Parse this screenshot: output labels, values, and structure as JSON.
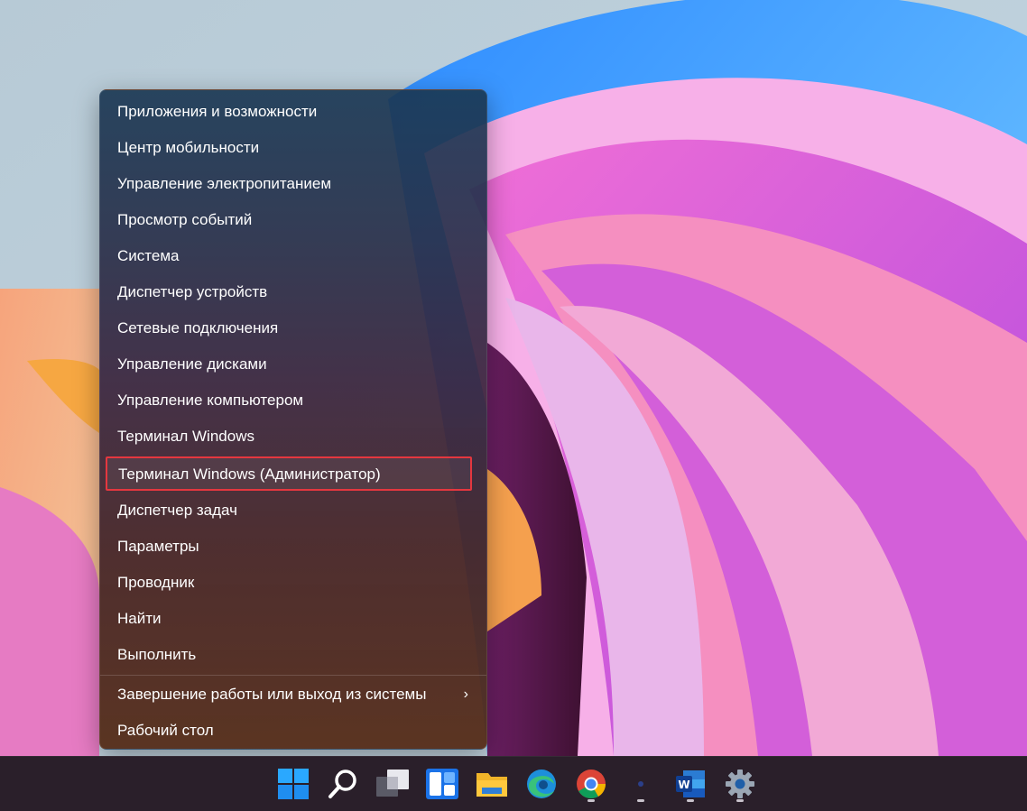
{
  "menu": {
    "items": [
      {
        "label": "Приложения и возможности"
      },
      {
        "label": "Центр мобильности"
      },
      {
        "label": "Управление электропитанием"
      },
      {
        "label": "Просмотр событий"
      },
      {
        "label": "Система"
      },
      {
        "label": "Диспетчер устройств"
      },
      {
        "label": "Сетевые подключения"
      },
      {
        "label": "Управление дисками"
      },
      {
        "label": "Управление компьютером"
      },
      {
        "label": "Терминал Windows"
      },
      {
        "label": "Терминал Windows (Администратор)"
      },
      {
        "label": "Диспетчер задач"
      },
      {
        "label": "Параметры"
      },
      {
        "label": "Проводник"
      },
      {
        "label": "Найти"
      },
      {
        "label": "Выполнить"
      },
      {
        "label": "Завершение работы или выход из системы",
        "icon": "chevron-right-icon"
      },
      {
        "label": "Рабочий стол"
      }
    ],
    "highlighted_index": 10,
    "highlight_color": "#e5373f"
  },
  "taskbar": {
    "icons": [
      {
        "name": "start-icon"
      },
      {
        "name": "search-icon"
      },
      {
        "name": "task-view-icon"
      },
      {
        "name": "widgets-icon"
      },
      {
        "name": "file-explorer-icon"
      },
      {
        "name": "edge-icon"
      },
      {
        "name": "chrome-icon"
      },
      {
        "name": "app-dot-icon"
      },
      {
        "name": "word-icon"
      },
      {
        "name": "settings-icon"
      }
    ]
  }
}
